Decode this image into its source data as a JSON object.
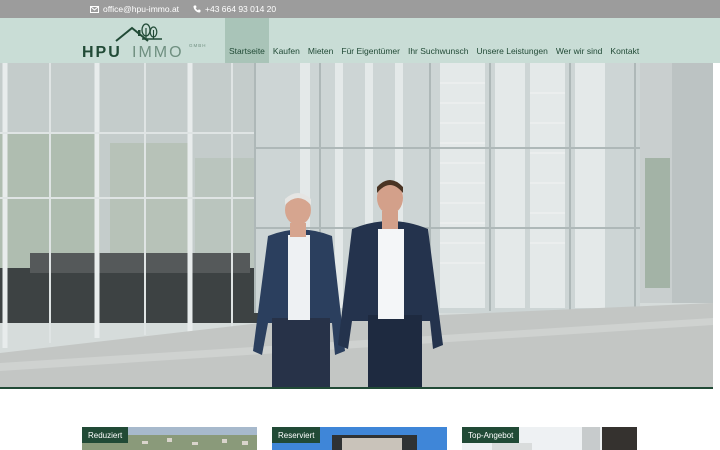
{
  "topbar": {
    "email": "office@hpu-immo.at",
    "phone": "+43 664 93 014 20"
  },
  "logo": {
    "brand_bold": "HPU",
    "brand_light": "IMMO",
    "suffix": "GMBH"
  },
  "nav": {
    "items": [
      {
        "label": "Startseite",
        "active": true
      },
      {
        "label": "Kaufen"
      },
      {
        "label": "Mieten"
      },
      {
        "label": "Für Eigentümer"
      },
      {
        "label": "Ihr Suchwunsch"
      },
      {
        "label": "Unsere Leistungen"
      },
      {
        "label": "Wer wir sind"
      },
      {
        "label": "Kontakt"
      }
    ]
  },
  "cards": [
    {
      "badge": "Reduziert"
    },
    {
      "badge": "Reserviert"
    },
    {
      "badge": "Top-Angebot"
    }
  ],
  "colors": {
    "brand_green": "#214a36",
    "nav_bg": "#c9ddd6",
    "nav_active": "#a9c4b8",
    "topbar_bg": "#9c9c9c"
  },
  "icons": {
    "email": "envelope-icon",
    "phone": "phone-icon"
  }
}
